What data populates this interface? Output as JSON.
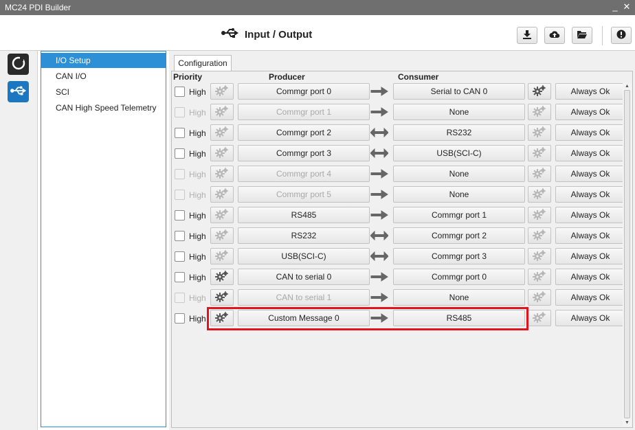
{
  "window": {
    "title": "MC24 PDI Builder"
  },
  "header": {
    "title": "Input / Output"
  },
  "toolbar_icons": [
    "download-icon",
    "cloud-upload-icon",
    "folder-open-icon",
    "info-icon"
  ],
  "leftbar": {
    "icons": [
      "power-icon",
      "usb-icon"
    ],
    "active_color": "#1c76c0"
  },
  "nav": {
    "items": [
      {
        "label": "I/O Setup",
        "selected": true
      },
      {
        "label": "CAN I/O",
        "selected": false
      },
      {
        "label": "SCI",
        "selected": false
      },
      {
        "label": "CAN High Speed Telemetry",
        "selected": false
      }
    ]
  },
  "tabs": [
    {
      "label": "Configuration"
    }
  ],
  "columns": {
    "priority": "Priority",
    "producer": "Producer",
    "consumer": "Consumer"
  },
  "rows": [
    {
      "high_label": "High",
      "producer": "Commgr port 0",
      "consumer": "Serial to CAN 0",
      "status": "Always Ok",
      "arrow": "right",
      "enabled": true,
      "producer_gear": false,
      "consumer_gear": true
    },
    {
      "high_label": "High",
      "producer": "Commgr port 1",
      "consumer": "None",
      "status": "Always Ok",
      "arrow": "right",
      "enabled": false,
      "producer_gear": false,
      "consumer_gear": false
    },
    {
      "high_label": "High",
      "producer": "Commgr port 2",
      "consumer": "RS232",
      "status": "Always Ok",
      "arrow": "both",
      "enabled": true,
      "producer_gear": false,
      "consumer_gear": false
    },
    {
      "high_label": "High",
      "producer": "Commgr port 3",
      "consumer": "USB(SCI-C)",
      "status": "Always Ok",
      "arrow": "both",
      "enabled": true,
      "producer_gear": false,
      "consumer_gear": false
    },
    {
      "high_label": "High",
      "producer": "Commgr port 4",
      "consumer": "None",
      "status": "Always Ok",
      "arrow": "right",
      "enabled": false,
      "producer_gear": false,
      "consumer_gear": false
    },
    {
      "high_label": "High",
      "producer": "Commgr port 5",
      "consumer": "None",
      "status": "Always Ok",
      "arrow": "right",
      "enabled": false,
      "producer_gear": false,
      "consumer_gear": false
    },
    {
      "high_label": "High",
      "producer": "RS485",
      "consumer": "Commgr port 1",
      "status": "Always Ok",
      "arrow": "right",
      "enabled": true,
      "producer_gear": false,
      "consumer_gear": false
    },
    {
      "high_label": "High",
      "producer": "RS232",
      "consumer": "Commgr port 2",
      "status": "Always Ok",
      "arrow": "both",
      "enabled": true,
      "producer_gear": false,
      "consumer_gear": false
    },
    {
      "high_label": "High",
      "producer": "USB(SCI-C)",
      "consumer": "Commgr port 3",
      "status": "Always Ok",
      "arrow": "both",
      "enabled": true,
      "producer_gear": false,
      "consumer_gear": false
    },
    {
      "high_label": "High",
      "producer": "CAN to serial 0",
      "consumer": "Commgr port 0",
      "status": "Always Ok",
      "arrow": "right",
      "enabled": true,
      "producer_gear": true,
      "consumer_gear": false
    },
    {
      "high_label": "High",
      "producer": "CAN to serial 1",
      "consumer": "None",
      "status": "Always Ok",
      "arrow": "right",
      "enabled": false,
      "producer_gear": true,
      "consumer_gear": false
    },
    {
      "high_label": "High",
      "producer": "Custom Message 0",
      "consumer": "RS485",
      "status": "Always Ok",
      "arrow": "right",
      "enabled": true,
      "producer_gear": true,
      "consumer_gear": false,
      "highlighted": true
    }
  ],
  "highlight_color": "#e0141e"
}
